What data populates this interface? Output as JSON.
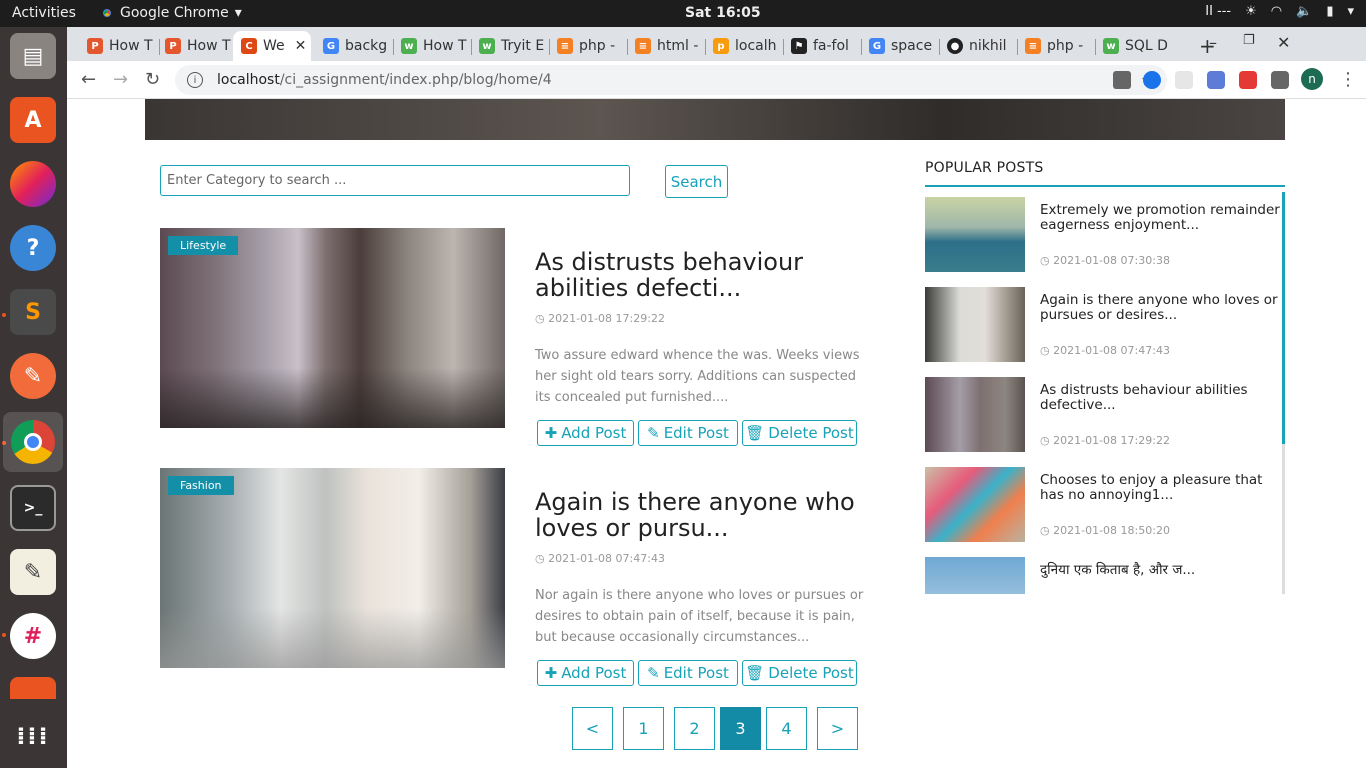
{
  "os": {
    "activities": "Activities",
    "app_name": "Google Chrome",
    "clock": "Sat 16:05",
    "tray_text": "II ---"
  },
  "browser": {
    "tabs": [
      {
        "label": "How T",
        "favicon": "ps-icon",
        "color": "#e4572e"
      },
      {
        "label": "How T",
        "favicon": "ps-icon",
        "color": "#e4572e"
      },
      {
        "label": "We",
        "favicon": "codeigniter-icon",
        "color": "#dd4814",
        "active": true
      },
      {
        "label": "backg",
        "favicon": "google-icon",
        "color": "#4285f4"
      },
      {
        "label": "How T",
        "favicon": "w3-icon",
        "color": "#4caf50"
      },
      {
        "label": "Tryit E",
        "favicon": "w3-icon",
        "color": "#4caf50"
      },
      {
        "label": "php -",
        "favicon": "stackoverflow-icon",
        "color": "#f48024"
      },
      {
        "label": "html -",
        "favicon": "stackoverflow-icon",
        "color": "#f48024"
      },
      {
        "label": "localh",
        "favicon": "phpmyadmin-icon",
        "color": "#f89c0e"
      },
      {
        "label": "fa-fol",
        "favicon": "flag-icon",
        "color": "#222222"
      },
      {
        "label": "space",
        "favicon": "google-icon",
        "color": "#4285f4"
      },
      {
        "label": "nikhil",
        "favicon": "github-icon",
        "color": "#222222"
      },
      {
        "label": "php -",
        "favicon": "stackoverflow-icon",
        "color": "#f48024"
      },
      {
        "label": "SQL D",
        "favicon": "w3-icon",
        "color": "#4caf50"
      }
    ],
    "url_host": "localhost",
    "url_path": "/ci_assignment/index.php/blog/home/4",
    "profile_initial": "n"
  },
  "search": {
    "placeholder": "Enter Category to search ...",
    "button_label": "Search"
  },
  "posts": [
    {
      "category": "Lifestyle",
      "title": "As distrusts behaviour abilities defecti...",
      "date": "2021-01-08 17:29:22",
      "excerpt": "Two assure edward whence the was. Weeks views her sight old tears sorry. Additions can suspected its concealed put furnished....",
      "add_label": "Add Post",
      "edit_label": "Edit Post",
      "delete_label": "Delete Post"
    },
    {
      "category": "Fashion",
      "title": "Again is there anyone who loves or pursu...",
      "date": "2021-01-08 07:47:43",
      "excerpt": "Nor again is there anyone who loves or pursues or desires to obtain pain of itself, because it is pain, but because occasionally circumstances...",
      "add_label": "Add Post",
      "edit_label": "Edit Post",
      "delete_label": "Delete Post"
    }
  ],
  "pagination": {
    "prev": "<",
    "pages": [
      "1",
      "2",
      "3",
      "4"
    ],
    "current": "3",
    "next": ">"
  },
  "sidebar": {
    "title": "POPULAR POSTS",
    "items": [
      {
        "title": "Extremely we promotion remainder eagerness enjoyment...",
        "date": "2021-01-08 07:30:38"
      },
      {
        "title": "Again is there anyone who loves or pursues or desires...",
        "date": "2021-01-08 07:47:43"
      },
      {
        "title": "As distrusts behaviour abilities defective...",
        "date": "2021-01-08 17:29:22"
      },
      {
        "title": "Chooses to enjoy a pleasure that has no annoying1...",
        "date": "2021-01-08 18:50:20"
      },
      {
        "title": "दुनिया एक किताब है, और ज...",
        "date": ""
      }
    ]
  },
  "colors": {
    "accent": "#17a2b8",
    "badge": "#1390a8",
    "active_page": "#138aa6"
  }
}
